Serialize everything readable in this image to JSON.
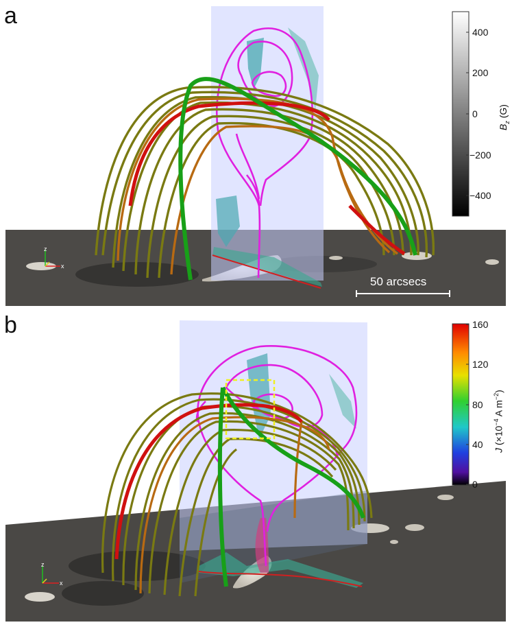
{
  "panels": {
    "a": {
      "label": "a",
      "colorbar": {
        "title": "B_z (G)",
        "title_main": "B",
        "title_sub": "z",
        "title_unit": " (G)",
        "ticks": [
          "400",
          "200",
          "0",
          "−200",
          "−400"
        ],
        "colormap": "grayscale"
      },
      "scale_bar": "50 arcsecs"
    },
    "b": {
      "label": "b",
      "colorbar": {
        "title": "J (×10⁻⁴ A m⁻²)",
        "title_main": "J",
        "title_unit": " (×10",
        "title_exp": "−4",
        "title_unit2": " A m",
        "title_exp2": "−2",
        "title_close": ")",
        "ticks": [
          "160",
          "120",
          "80",
          "40",
          "0"
        ],
        "colormap": "rainbow"
      }
    }
  },
  "axes_triad": {
    "x": "x",
    "y": "y",
    "z": "z"
  },
  "colors": {
    "field_lines_yellow": "#7a7a12",
    "field_lines_orange": "#c06010",
    "field_lines_red": "#d01010",
    "field_lines_green": "#18a018",
    "contour_magenta": "#e020e0",
    "slice_tint": "#c8d0ff",
    "surface": "#4a4845"
  }
}
